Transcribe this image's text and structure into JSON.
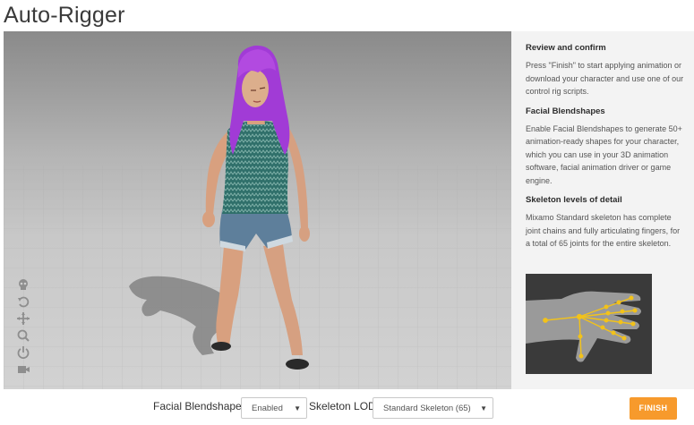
{
  "app": {
    "title": "Auto-Rigger"
  },
  "sidebar": {
    "sections": [
      {
        "heading": "Review and confirm",
        "body": "Press \"Finish\" to start applying animation or download your character and use one of our control rig scripts."
      },
      {
        "heading": "Facial Blendshapes",
        "body": "Enable Facial Blendshapes to generate 50+ animation-ready shapes for your character, which you can use in your 3D animation software, facial animation driver or game engine."
      },
      {
        "heading": "Skeleton levels of detail",
        "body": "Mixamo Standard skeleton has complete joint chains and fully articulating fingers, for a total of 65 joints for the entire skeleton."
      }
    ]
  },
  "viewport": {
    "tools": [
      "skull-icon",
      "undo-icon",
      "move-icon",
      "zoom-icon",
      "rotate-icon",
      "camera-icon"
    ]
  },
  "footer": {
    "blendshapes_label": "Facial Blendshapes",
    "blendshapes_value": "Enabled",
    "lod_label": "Skeleton LOD",
    "lod_value": "Standard Skeleton (65)",
    "finish_label": "FINISH"
  },
  "colors": {
    "accent": "#f79a2c",
    "hair": "#a13bd6",
    "top": "#2f6f6a",
    "shorts": "#5e7f9b",
    "sidebar_bg": "#f3f3f3"
  }
}
